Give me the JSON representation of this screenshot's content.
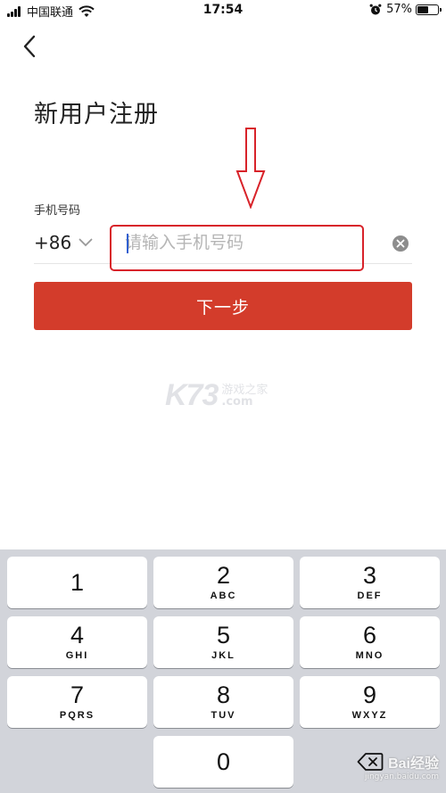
{
  "status_bar": {
    "carrier": "中国联通",
    "time": "17:54",
    "battery_percent": "57%",
    "battery_level": 0.57,
    "icons": [
      "signal-icon",
      "wifi-icon",
      "alarm-icon",
      "battery-icon"
    ]
  },
  "header": {
    "back_icon": "chevron-left-icon",
    "title": "新用户注册"
  },
  "form": {
    "phone_label": "手机号码",
    "country_code": "+86",
    "phone_placeholder": "请输入手机号码",
    "phone_value": "",
    "clear_icon": "clear-icon",
    "next_button": "下一步"
  },
  "annotation": {
    "arrow_color": "#d8232a",
    "box_color": "#d8232a"
  },
  "watermark": {
    "logo": "K73",
    "name": "游戏之家",
    "domain": ".com"
  },
  "keyboard": {
    "keys": [
      {
        "digit": "1",
        "letters": ""
      },
      {
        "digit": "2",
        "letters": "ABC"
      },
      {
        "digit": "3",
        "letters": "DEF"
      },
      {
        "digit": "4",
        "letters": "GHI"
      },
      {
        "digit": "5",
        "letters": "JKL"
      },
      {
        "digit": "6",
        "letters": "MNO"
      },
      {
        "digit": "7",
        "letters": "PQRS"
      },
      {
        "digit": "8",
        "letters": "TUV"
      },
      {
        "digit": "9",
        "letters": "WXYZ"
      },
      {
        "digit": "0",
        "letters": ""
      }
    ],
    "delete_icon": "backspace-icon"
  },
  "baidu_watermark": {
    "brand": "Bai经验",
    "url": "jingyan.baidu.com"
  },
  "colors": {
    "accent": "#d33c2b",
    "annotation_red": "#d8232a",
    "keyboard_bg": "#d2d4da",
    "caret": "#2f5fd0"
  }
}
